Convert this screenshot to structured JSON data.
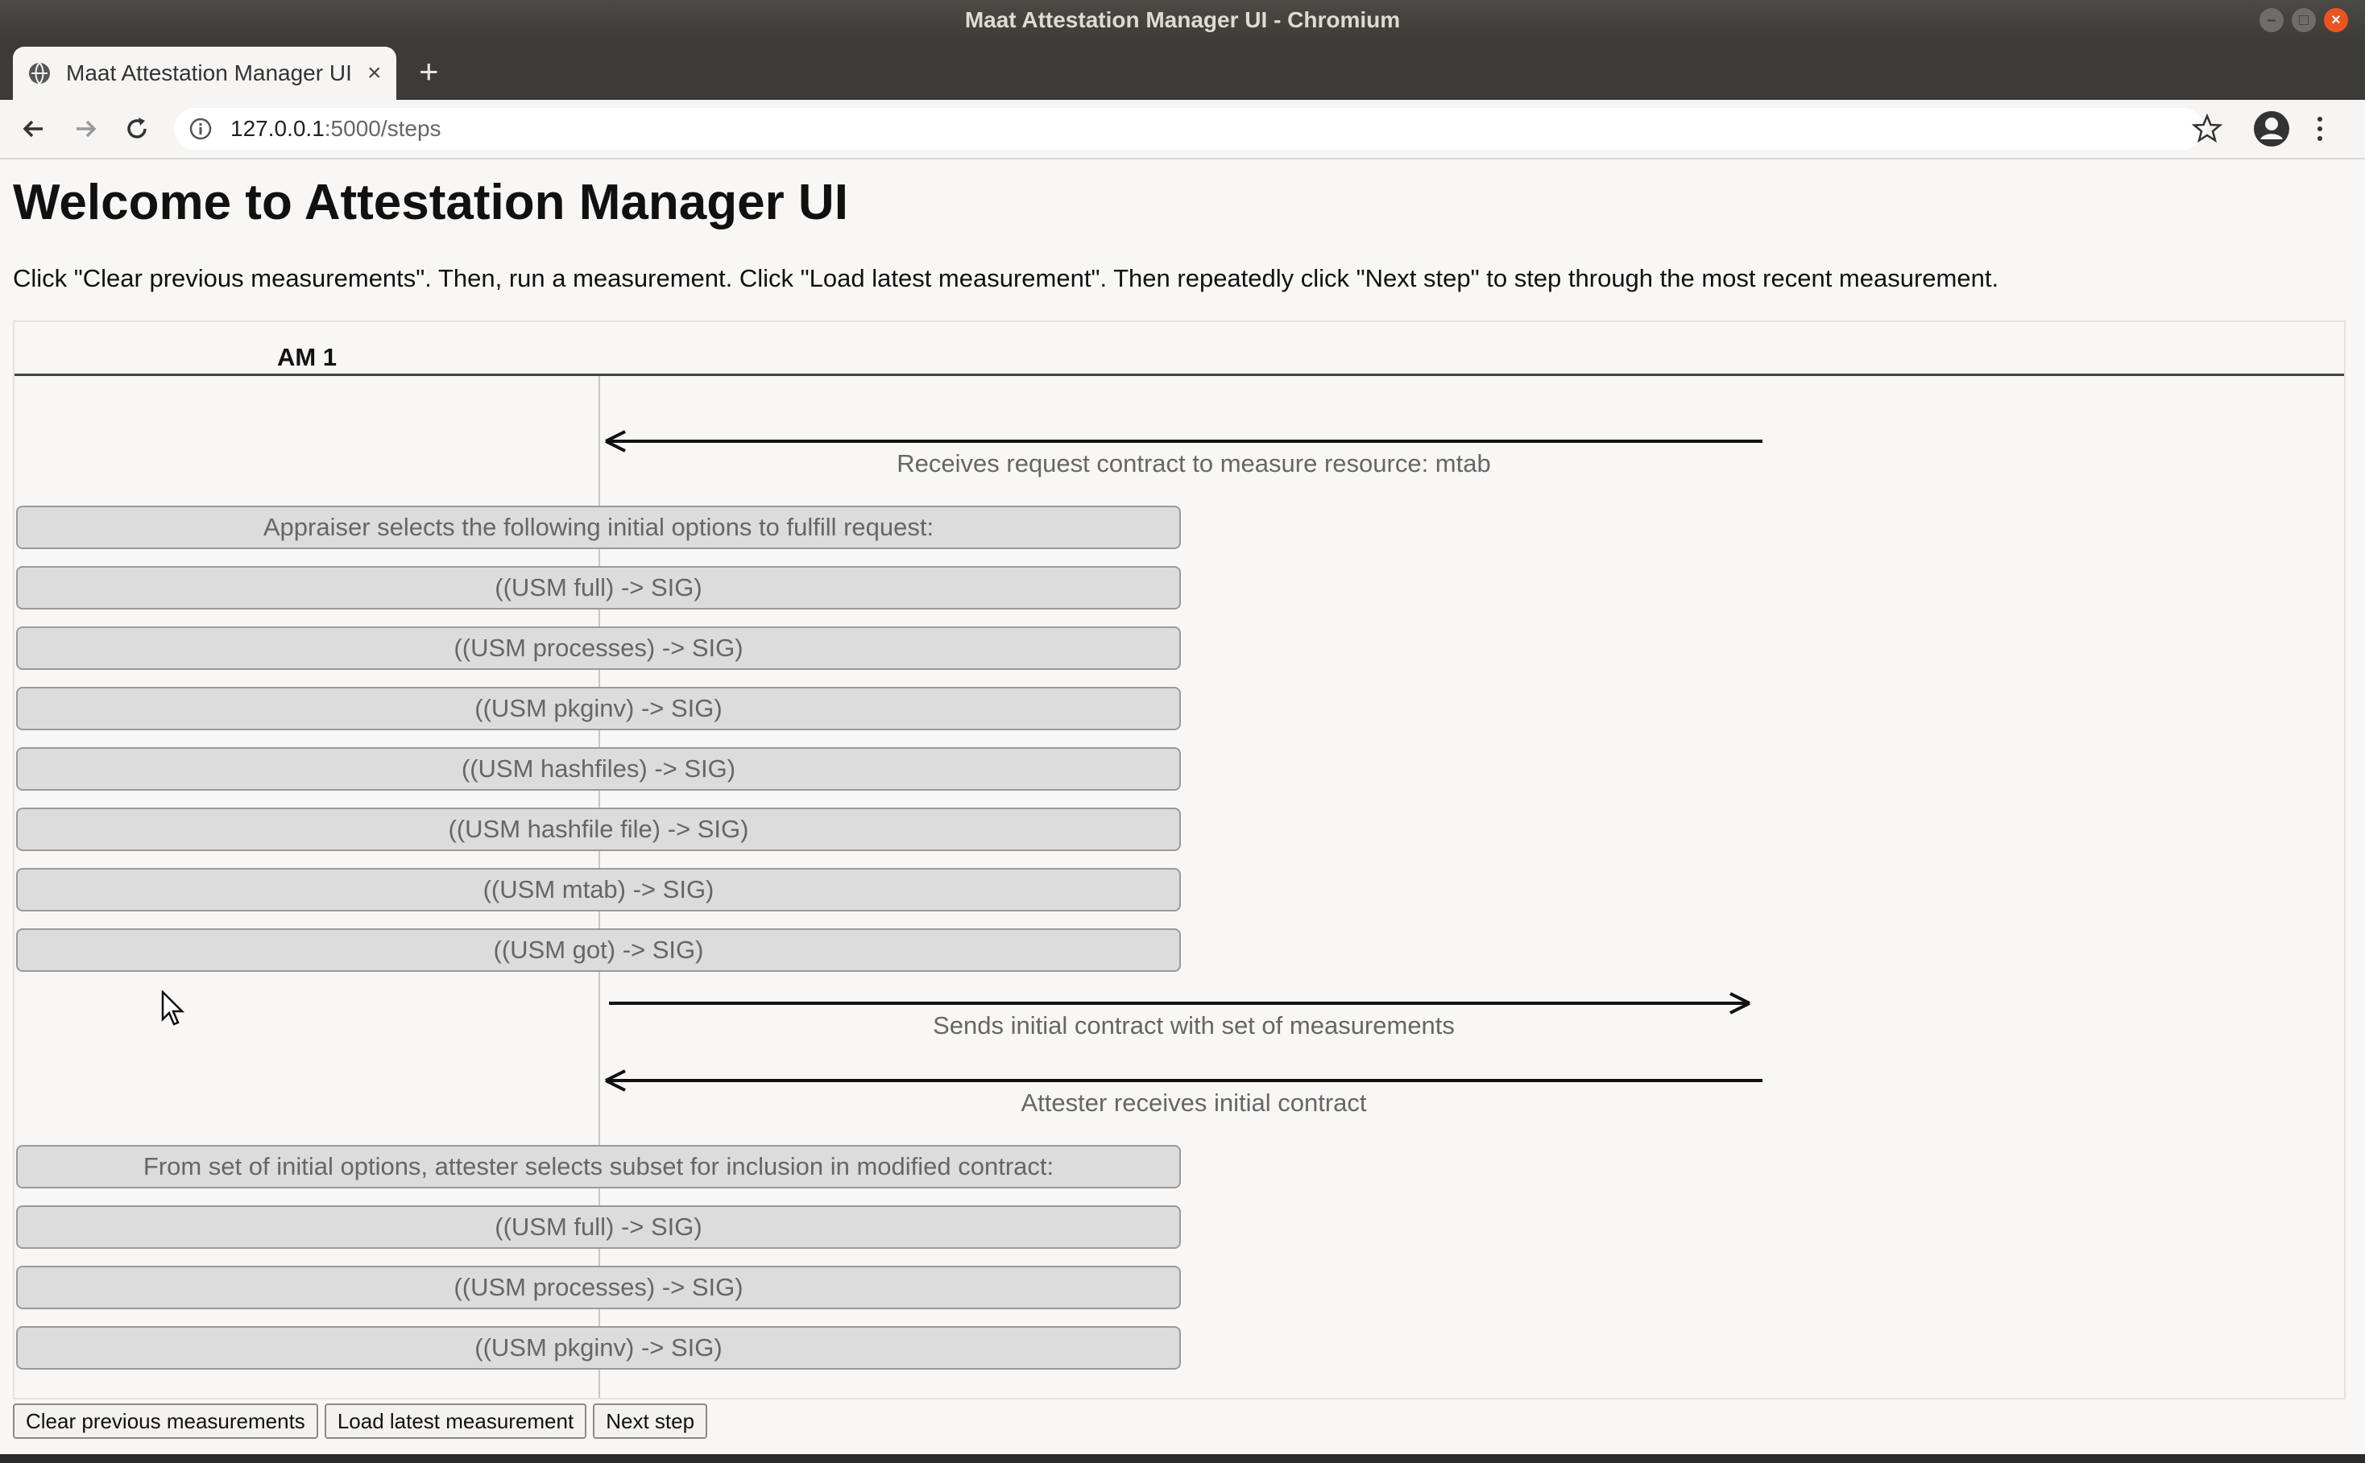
{
  "window": {
    "title": "Maat Attestation Manager UI - Chromium"
  },
  "browser": {
    "tab_title": "Maat Attestation Manager UI",
    "url_host": "127.0.0.1",
    "url_path": ":5000/steps"
  },
  "page": {
    "title": "Welcome to Attestation Manager UI",
    "instructions": "Click \"Clear previous measurements\". Then, run a measurement. Click \"Load latest measurement\". Then repeatedly click \"Next step\" to step through the most recent measurement."
  },
  "diagram": {
    "lane_header": "AM 1",
    "messages": {
      "m1": "Receives request contract to measure resource: mtab",
      "m2": "Sends initial contract with set of measurements",
      "m3": "Attester receives initial contract"
    },
    "steps": [
      "Appraiser selects the following initial options to fulfill request:",
      "((USM full) -> SIG)",
      "((USM processes) -> SIG)",
      "((USM pkginv) -> SIG)",
      "((USM hashfiles) -> SIG)",
      "((USM hashfile file) -> SIG)",
      "((USM mtab) -> SIG)",
      "((USM got) -> SIG)",
      "From set of initial options, attester selects subset for inclusion in modified contract:",
      "((USM full) -> SIG)",
      "((USM processes) -> SIG)",
      "((USM pkginv) -> SIG)"
    ]
  },
  "buttons": {
    "clear": "Clear previous measurements",
    "load": "Load latest measurement",
    "next": "Next step"
  }
}
